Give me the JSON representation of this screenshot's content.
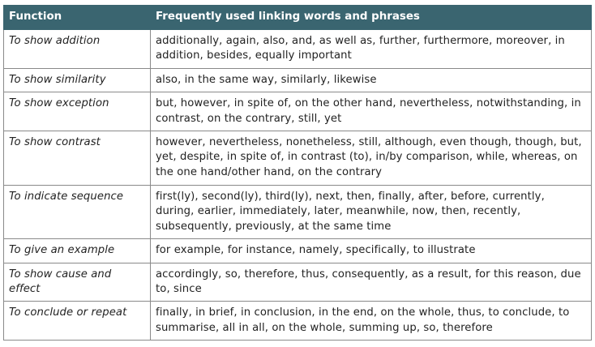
{
  "table": {
    "headers": {
      "function": "Function",
      "phrases": "Frequently used linking words and phrases"
    },
    "rows": [
      {
        "function": "To show addition",
        "phrases": "additionally, again, also, and, as well as, further, furthermore, moreover, in addition, besides, equally important"
      },
      {
        "function": "To show similarity",
        "phrases": "also, in the same way, similarly, likewise"
      },
      {
        "function": "To show exception",
        "phrases": "but, however, in spite of, on the other hand, nevertheless, notwithstanding, in contrast, on the contrary, still, yet"
      },
      {
        "function": "To show contrast",
        "phrases": "however, nevertheless, nonetheless, still, although, even though, though, but, yet, despite, in spite of, in contrast (to), in/by comparison, while, whereas, on the one hand/other hand, on the contrary"
      },
      {
        "function": "To indicate sequence",
        "phrases": "first(ly), second(ly), third(ly), next, then, finally, after, before, currently, during, earlier, immediately, later, meanwhile, now, then, recently, subsequently, previously, at the same time"
      },
      {
        "function": "To give an example",
        "phrases": "for example, for instance, namely, specifically, to illustrate"
      },
      {
        "function": "To show cause and effect",
        "phrases": "accordingly, so, therefore, thus, consequently, as a result, for this reason, due to, since"
      },
      {
        "function": "To conclude or repeat",
        "phrases": "finally, in brief, in conclusion, in the end, on the whole, thus, to conclude, to summarise, all in all, on the whole, summing up, so, therefore"
      }
    ]
  },
  "colors": {
    "header_bg": "#3a6570",
    "header_text": "#ffffff",
    "border": "#8a8a8a",
    "body_text": "#222222"
  }
}
